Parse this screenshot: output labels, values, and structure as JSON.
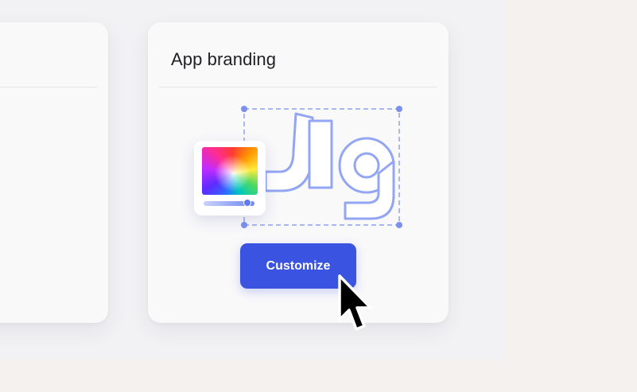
{
  "panel": {
    "title": "App branding"
  },
  "logo": {
    "text": "Jig",
    "outline_color": "#93a6f3",
    "handle_color": "#7c91ef"
  },
  "color_picker": {
    "slider_fill": "#6f86f1"
  },
  "actions": {
    "customize_label": "Customize",
    "button_color": "#3a53e0"
  },
  "icons": {
    "pointer": "mouse-pointer-icon"
  }
}
